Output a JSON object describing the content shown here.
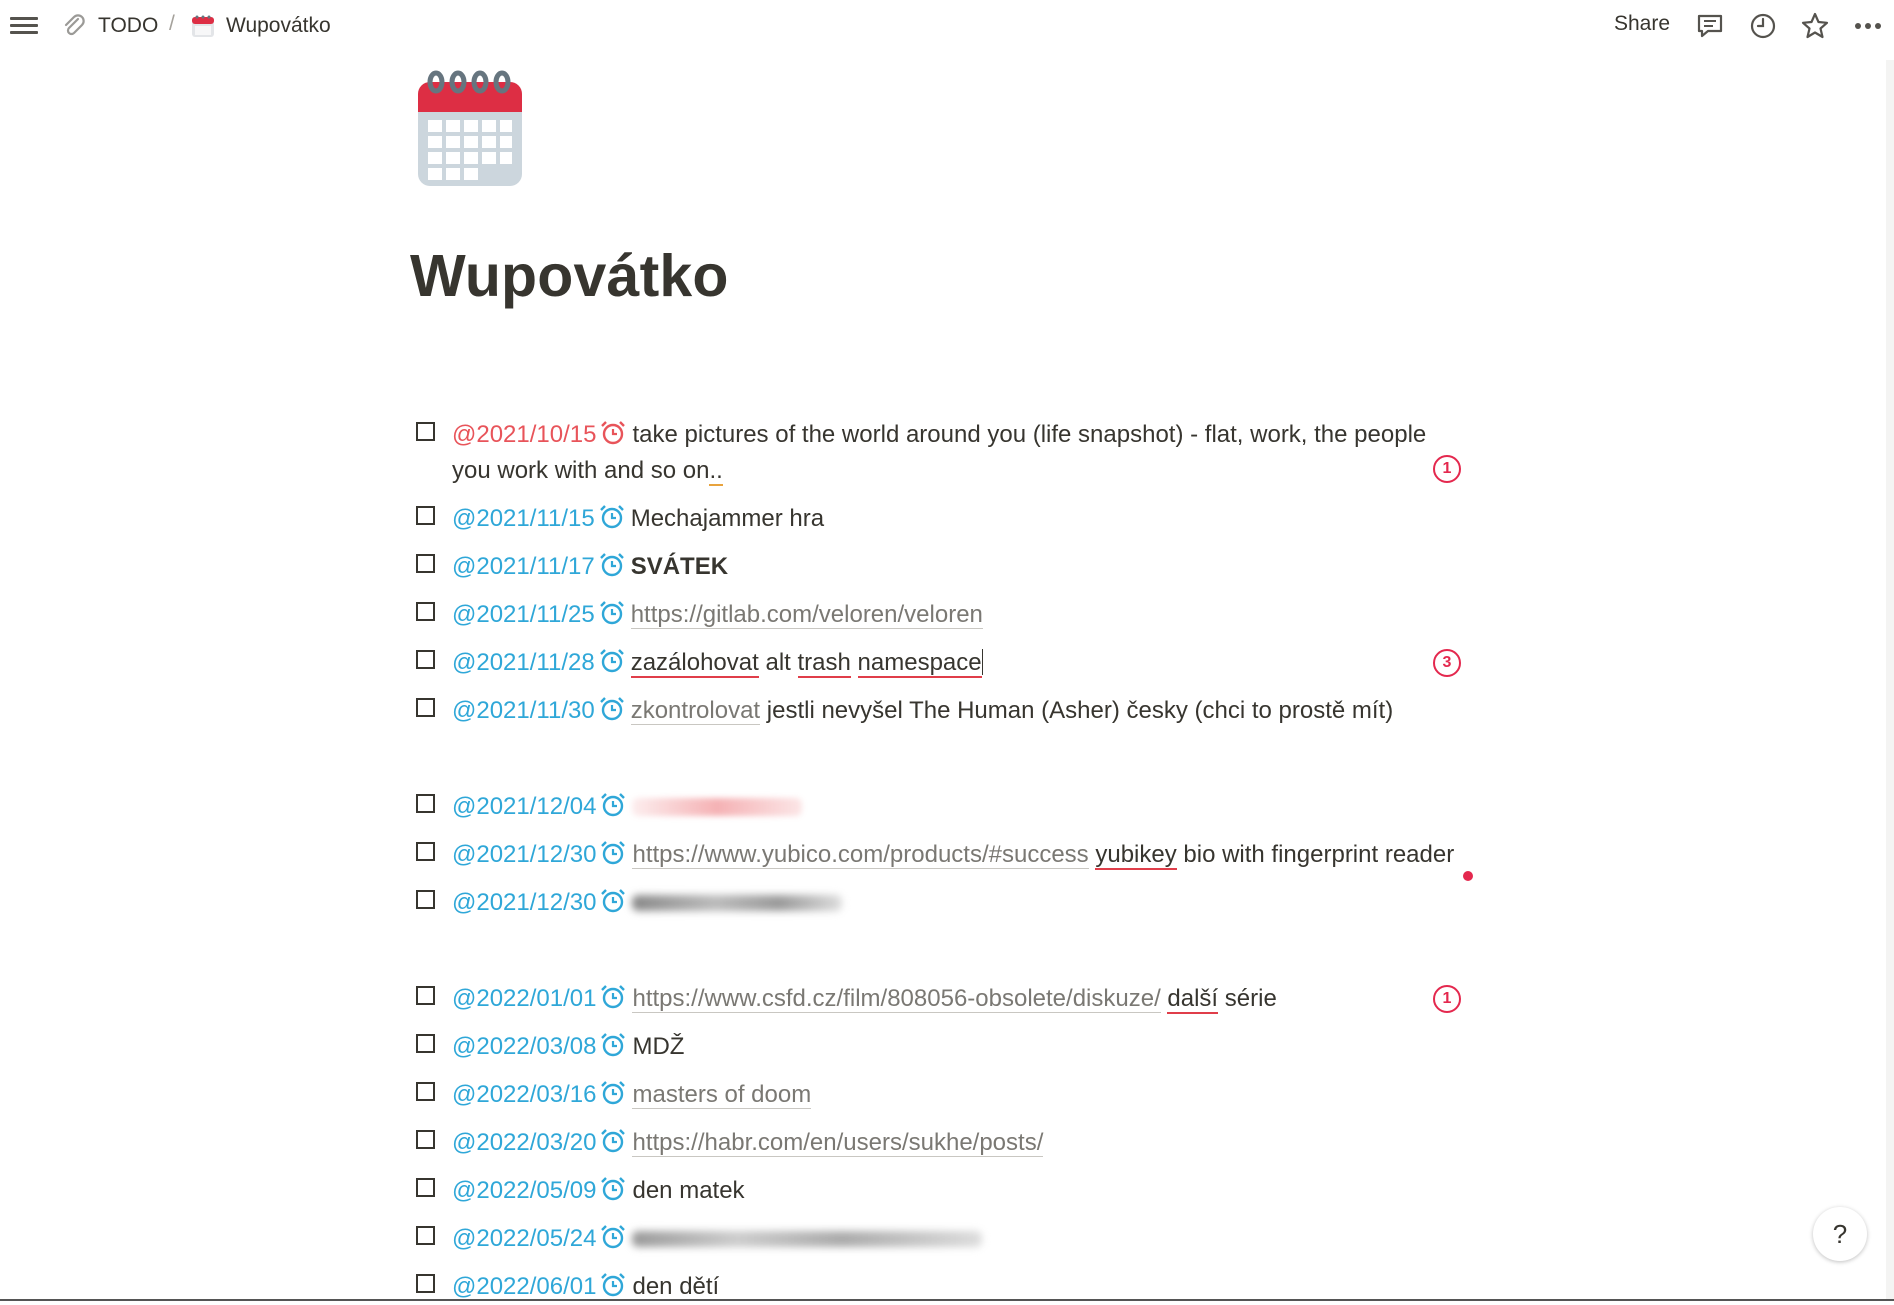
{
  "breadcrumb": {
    "parent": "TODO",
    "separator": "/",
    "current": "Wupovátko"
  },
  "topbar": {
    "share_label": "Share",
    "icons": [
      "comment-icon",
      "history-icon",
      "star-icon",
      "more-icon"
    ]
  },
  "page": {
    "icon": "calendar-icon",
    "title": "Wupovátko"
  },
  "todos": [
    {
      "date": "@2021/10/15",
      "text_line1": "take pictures of the world around you (life snapshot) - flat, work, the people",
      "text_line2_a": "you work with and so on",
      "text_line2_b": "..",
      "overdue": true,
      "comment_count": "1"
    },
    {
      "date": "@2021/11/15",
      "text": "Mechajammer hra"
    },
    {
      "date": "@2021/11/17",
      "text": "SVÁTEK"
    },
    {
      "date": "@2021/11/25",
      "link": "https://gitlab.com/veloren/veloren"
    },
    {
      "date": "@2021/11/28",
      "w1": "zazálohovat",
      "w2": "alt",
      "w3": "trash",
      "w4": "namespace",
      "comment_count": "3"
    },
    {
      "date": "@2021/11/30",
      "link": "zkontrolovat",
      "text": "jestli nevyšel The Human (Asher) česky (chci to prostě mít)"
    },
    {
      "date": "@2021/12/04"
    },
    {
      "date": "@2021/12/30",
      "link": "https://www.yubico.com/products/#success",
      "w1": "yubikey",
      "text": "bio with fingerprint reader"
    },
    {
      "date": "@2021/12/30"
    },
    {
      "date": "@2022/01/01",
      "link": "https://www.csfd.cz/film/808056-obsolete/diskuze/",
      "w1": "další",
      "text": "série",
      "comment_count": "1"
    },
    {
      "date": "@2022/03/08",
      "text": "MDŽ"
    },
    {
      "date": "@2022/03/16",
      "link": "masters of doom"
    },
    {
      "date": "@2022/03/20",
      "link": "https://habr.com/en/users/sukhe/posts/"
    },
    {
      "date": "@2022/05/09",
      "text": "den matek"
    },
    {
      "date": "@2022/05/24"
    },
    {
      "date": "@2022/06/01",
      "text": "den dětí"
    }
  ],
  "help_label": "?",
  "colors": {
    "date_blue": "#2fa7d8",
    "date_overdue": "#e8545a",
    "badge_red": "#e4284e",
    "text": "#37352f"
  }
}
